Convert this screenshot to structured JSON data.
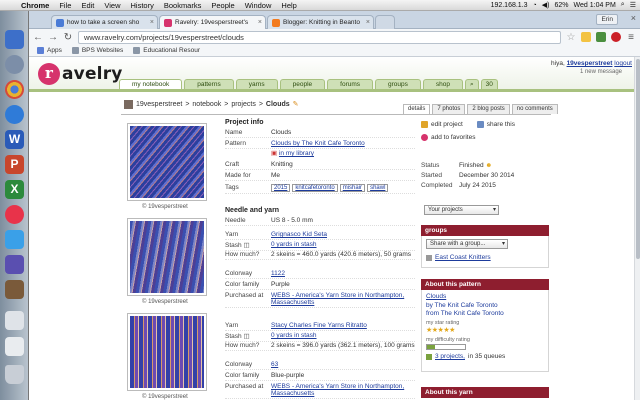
{
  "menubar": {
    "apple": "",
    "items": [
      "Chrome",
      "File",
      "Edit",
      "View",
      "History",
      "Bookmarks",
      "People",
      "Window",
      "Help"
    ],
    "ip": "192.168.1.3",
    "battery": "62%",
    "clock": "Wed 1:04 PM"
  },
  "tabs": [
    {
      "title": "how to take a screen sho",
      "color": "#4a7bd6"
    },
    {
      "title": "Ravelry: 19vesperstreet's",
      "color": "#d6336c"
    },
    {
      "title": "Blogger: Knitting in Beanto",
      "color": "#f27b1f"
    }
  ],
  "user_button": "Erin",
  "omnibox": "www.ravelry.com/projects/19vesperstreet/clouds",
  "bookmarks": [
    {
      "label": "Apps",
      "color": "#5b7fd6"
    },
    {
      "label": "BPS Websites",
      "color": "#666"
    },
    {
      "label": "Educational Resour",
      "color": "#666"
    }
  ],
  "site": {
    "logo_letter": "r",
    "logo_text": "avelry",
    "greeting": "hiya,",
    "username": "19vesperstreet",
    "logout": "logout",
    "messages": "1 new message",
    "nav": [
      "my notebook",
      "patterns",
      "yarns",
      "people",
      "forums",
      "groups",
      "shop"
    ],
    "nav_search_count": "30"
  },
  "breadcrumb": {
    "user": "19vesperstreet",
    "notebook": "notebook",
    "projects": "projects",
    "current": "Clouds"
  },
  "subtabs": [
    {
      "label": "details"
    },
    {
      "label": "7 photos"
    },
    {
      "label": "2 blog posts"
    },
    {
      "label": "no comments"
    }
  ],
  "photo_caption": "© 19vesperstreet",
  "project_info": {
    "heading": "Project info",
    "rows": [
      {
        "k": "Name",
        "v": "Clouds"
      },
      {
        "k": "Pattern",
        "v": "Clouds by The Knit Cafe Toronto"
      },
      {
        "k": "",
        "v": "in my library"
      },
      {
        "k": "Craft",
        "v": "Knitting"
      },
      {
        "k": "Made for",
        "v": "Me"
      }
    ],
    "tags_label": "Tags",
    "tags": [
      "2015",
      "knitcafetoronto",
      "mishair",
      "shawl"
    ]
  },
  "needle_yarn": {
    "heading": "Needle and yarn",
    "needle_label": "Needle",
    "needle": "US 8 - 5.0 mm",
    "yarns": [
      {
        "yarn": "Grignasco Kid Seta",
        "stash": "0 yards in stash",
        "how_much": "2 skeins = 460.0 yards (420.6 meters), 50 grams",
        "colorway": "1122",
        "color_family": "Purple",
        "purchased_at": "WEBS - America's Yarn Store in Northampton, Massachusetts"
      },
      {
        "yarn": "Stacy Charles Fine Yarns Ritratto",
        "stash": "0 yards in stash",
        "how_much": "2 skeins = 396.0 yards (362.1 meters), 100 grams",
        "colorway": "63",
        "color_family": "Blue-purple",
        "purchased_at": "WEBS - America's Yarn Store in Northampton, Massachusetts"
      }
    ],
    "labels": {
      "yarn": "Yarn",
      "stash": "Stash",
      "how_much": "How much?",
      "colorway": "Colorway",
      "color_family": "Color family",
      "purchased_at": "Purchased at"
    }
  },
  "actions": {
    "edit": "edit project",
    "share": "share this",
    "favorites": "add to favorites"
  },
  "status": {
    "status_label": "Status",
    "status": "Finished",
    "started_label": "Started",
    "started": "December 30 2014",
    "completed_label": "Completed",
    "completed": "July 24 2015"
  },
  "your_projects_select": "Your projects",
  "groups_box": {
    "heading": "groups",
    "select": "Share with a group...",
    "group": "East Coast Knitters"
  },
  "pattern_box": {
    "heading": "About this pattern",
    "name": "Clouds",
    "by": "by The Knit Cafe Toronto",
    "from": "from The Knit Cafe Toronto",
    "star_label": "my star rating",
    "stars": 5,
    "stars_text": "★★★★★",
    "diff_label": "my difficulty rating",
    "difficulty": 0.2,
    "projects": "3 projects,",
    "queues": "in 35 queues"
  },
  "yarn_box": {
    "heading": "About this yarn"
  }
}
